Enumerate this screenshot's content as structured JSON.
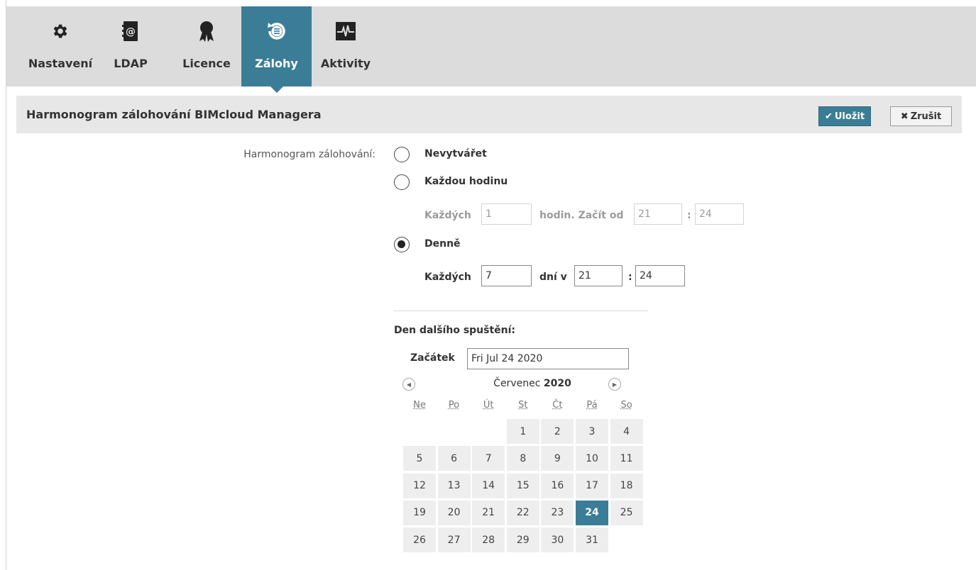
{
  "tabs": [
    {
      "label": "Nastavení",
      "icon": "gear-icon"
    },
    {
      "label": "LDAP",
      "icon": "address-book-icon"
    },
    {
      "label": "Licence",
      "icon": "award-icon"
    },
    {
      "label": "Zálohy",
      "icon": "backup-icon",
      "active": true
    },
    {
      "label": "Aktivity",
      "icon": "activity-icon"
    }
  ],
  "panel": {
    "title": "Harmonogram zálohování BIMcloud Managera",
    "save_label": "Uložit",
    "cancel_label": "Zrušit"
  },
  "schedule": {
    "label": "Harmonogram zálohování:",
    "options": {
      "never": "Nevytvářet",
      "hourly": "Každou hodinu",
      "daily": "Denně"
    },
    "selected": "daily",
    "hourly": {
      "every_label": "Každých",
      "every_value": "1",
      "start_label": "hodin. Začít od",
      "hour": "21",
      "colon": ":",
      "minute": "24"
    },
    "daily": {
      "every_label": "Každých",
      "every_value": "7",
      "at_label": "dní v",
      "hour": "21",
      "colon": ":",
      "minute": "24"
    }
  },
  "next_run": {
    "heading": "Den dalšího spuštění:",
    "start_label": "Začátek",
    "start_value": "Fri Jul 24 2020"
  },
  "calendar": {
    "month": "Červenec",
    "year": "2020",
    "weekdays": [
      "Ne",
      "Po",
      "Út",
      "St",
      "Čt",
      "Pá",
      "So"
    ],
    "first_weekday_index": 3,
    "days_in_month": 31,
    "selected_day": 24
  },
  "colors": {
    "accent": "#3b7d96",
    "topbar": "#dcdcdc",
    "titlebar": "#e7e7e7"
  }
}
